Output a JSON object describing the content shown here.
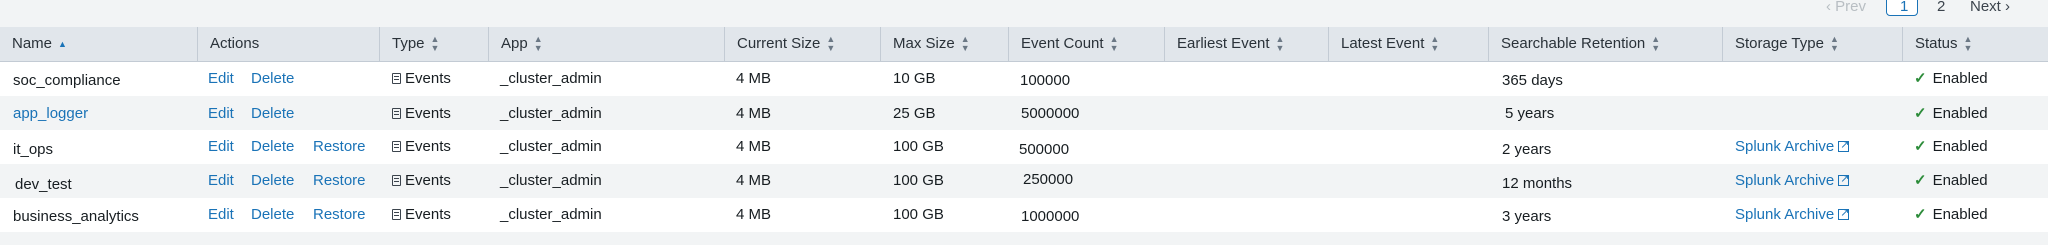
{
  "pagination": {
    "prev": "‹ Prev",
    "current": "1",
    "page2": "2",
    "next": "Next ›"
  },
  "columns": [
    {
      "label": "Name"
    },
    {
      "label": "Actions"
    },
    {
      "label": "Type"
    },
    {
      "label": "App"
    },
    {
      "label": "Current Size"
    },
    {
      "label": "Max Size"
    },
    {
      "label": "Event Count"
    },
    {
      "label": "Earliest Event"
    },
    {
      "label": "Latest Event"
    },
    {
      "label": "Searchable Retention"
    },
    {
      "label": "Storage Type"
    },
    {
      "label": "Status"
    }
  ],
  "actions": {
    "edit": "Edit",
    "delete": "Delete",
    "restore": "Restore"
  },
  "rows": [
    {
      "name": "soc_compliance",
      "type": "Events",
      "app": "_cluster_admin",
      "current_size": "4 MB",
      "max_size": "10 GB",
      "event_count": "100000",
      "earliest": "",
      "latest": "",
      "retention": "365 days",
      "storage": "",
      "status": "Enabled"
    },
    {
      "name": "app_logger",
      "type": "Events",
      "app": "_cluster_admin",
      "current_size": "4 MB",
      "max_size": "25 GB",
      "event_count": "5000000",
      "earliest": "",
      "latest": "",
      "retention": "5 years",
      "storage": "",
      "status": "Enabled"
    },
    {
      "name": "it_ops",
      "type": "Events",
      "app": "_cluster_admin",
      "current_size": "4 MB",
      "max_size": "100 GB",
      "event_count": "500000",
      "earliest": "",
      "latest": "",
      "retention": "2 years",
      "storage": "Splunk Archive",
      "status": "Enabled"
    },
    {
      "name": "dev_test",
      "type": "Events",
      "app": "_cluster_admin",
      "current_size": "4 MB",
      "max_size": "100 GB",
      "event_count": "250000",
      "earliest": "",
      "latest": "",
      "retention": "12 months",
      "storage": "Splunk Archive",
      "status": "Enabled"
    },
    {
      "name": "business_analytics",
      "type": "Events",
      "app": "_cluster_admin",
      "current_size": "4 MB",
      "max_size": "100 GB",
      "event_count": "1000000",
      "earliest": "",
      "latest": "",
      "retention": "3 years",
      "storage": "Splunk Archive",
      "status": "Enabled"
    }
  ]
}
